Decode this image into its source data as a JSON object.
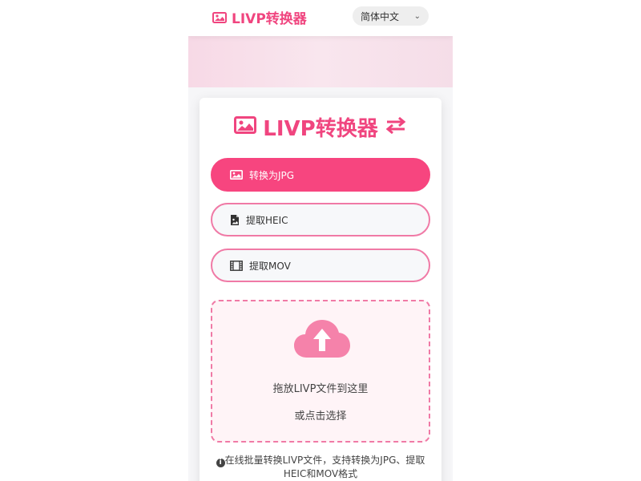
{
  "header": {
    "brand": "LIVP转换器",
    "language": "简体中文"
  },
  "card": {
    "title": "LIVP转换器",
    "modes": [
      {
        "label": "转换为JPG",
        "icon": "image-icon",
        "active": true
      },
      {
        "label": "提取HEIC",
        "icon": "file-image-icon",
        "active": false
      },
      {
        "label": "提取MOV",
        "icon": "film-icon",
        "active": false
      }
    ],
    "dropzone": {
      "primary": "拖放LIVP文件到这里",
      "secondary": "或点击选择"
    },
    "info": "在线批量转换LIVP文件，支持转换为JPG、提取HEIC和MOV格式"
  },
  "colors": {
    "accent": "#f7457f",
    "accent_border": "#f07aa6",
    "dropzone_bg": "#fff4f7"
  }
}
